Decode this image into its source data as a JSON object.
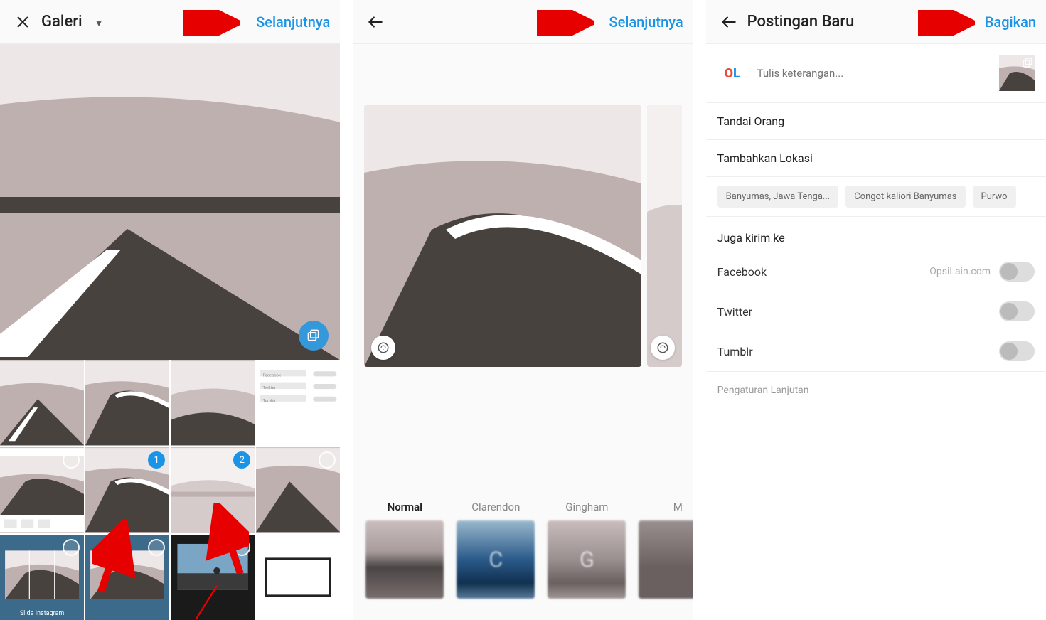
{
  "screen1": {
    "title": "Galeri",
    "action": "Selanjutnya",
    "thumbs": {
      "badge1": "1",
      "badge2": "2",
      "album_label": "Slide Instagram"
    }
  },
  "screen2": {
    "action": "Selanjutnya",
    "filters": [
      {
        "name": "Normal",
        "letter": "",
        "bg": "linear-gradient(180deg,#c9bdbd 0%,#a89b9b 40%,#4a4544 60%,#7a6e6e 100%)",
        "active": true
      },
      {
        "name": "Clarendon",
        "letter": "C",
        "bg": "linear-gradient(180deg,#9ab8cc 0%,#2a5a8a 50%,#103050 80%,#5a7a9a 100%)",
        "active": false
      },
      {
        "name": "Gingham",
        "letter": "G",
        "bg": "linear-gradient(180deg,#c8bcbc 0%,#9a8f8f 50%,#6a6060 80%,#a09595 100%)",
        "active": false
      },
      {
        "name": "M",
        "letter": "",
        "bg": "linear-gradient(180deg,#9a8f8f 0%,#6a6060 60%)",
        "active": false
      }
    ]
  },
  "screen3": {
    "title": "Postingan Baru",
    "action": "Bagikan",
    "avatar": {
      "text_o": "O",
      "text_l": "L"
    },
    "caption_placeholder": "Tulis keterangan...",
    "tag_people": "Tandai Orang",
    "add_location": "Tambahkan Lokasi",
    "locations": [
      "Banyumas, Jawa Tenga...",
      "Congot kaliori Banyumas",
      "Purwo"
    ],
    "also_post": "Juga kirim ke",
    "shares": [
      {
        "name": "Facebook",
        "account": "OpsiLain.com"
      },
      {
        "name": "Twitter",
        "account": ""
      },
      {
        "name": "Tumblr",
        "account": ""
      }
    ],
    "advanced": "Pengaturan Lanjutan"
  }
}
